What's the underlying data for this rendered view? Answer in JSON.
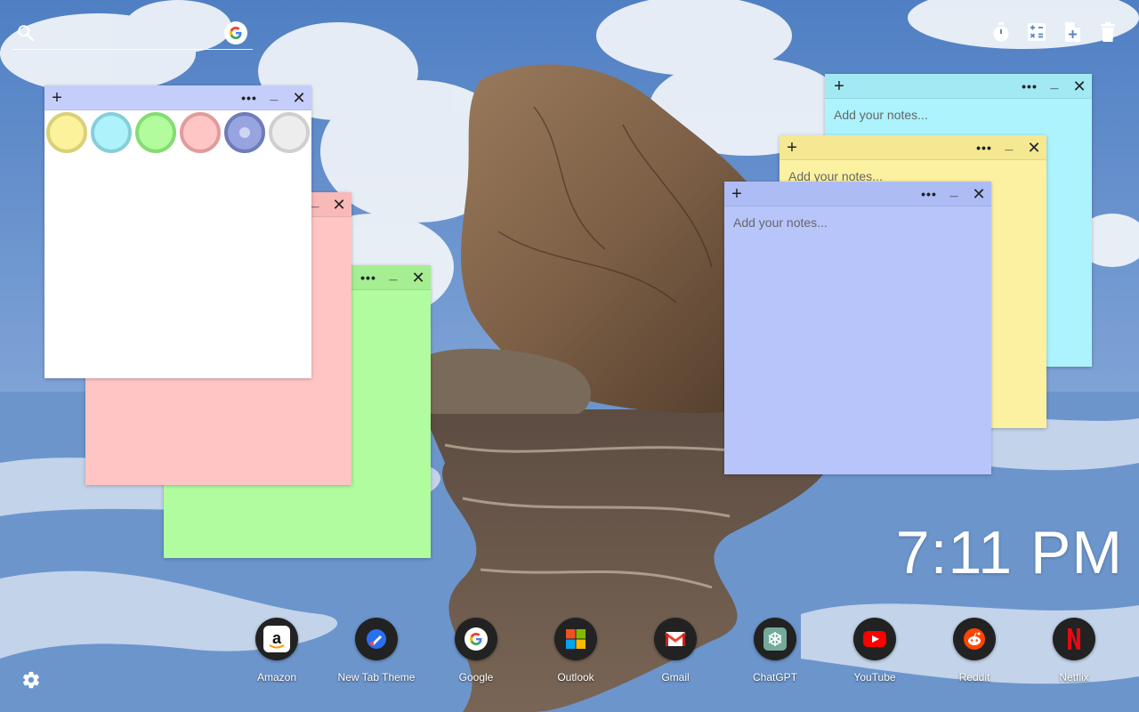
{
  "search": {
    "placeholder": ""
  },
  "top_tools": [
    "stopwatch-icon",
    "calculator-icon",
    "add-note-icon",
    "trash-icon"
  ],
  "notes": {
    "placeholder": "Add your notes...",
    "add_symbol": "+",
    "more_symbol": "•••",
    "min_symbol": "_",
    "close_symbol": "✕"
  },
  "note_colors": {
    "yellow": "#fcf1a1",
    "cyan": "#acf3fd",
    "green": "#b1fc9e",
    "pink": "#ffc5c5",
    "blue": "#b8c5fb",
    "white": "#ffffff"
  },
  "swatches": [
    {
      "name": "yellow",
      "fill": "#fdf29c",
      "ring": "#d9d077"
    },
    {
      "name": "cyan",
      "fill": "#aef2fc",
      "ring": "#86cfd9"
    },
    {
      "name": "green",
      "fill": "#b2fc9e",
      "ring": "#85dc72"
    },
    {
      "name": "pink",
      "fill": "#ffc6c6",
      "ring": "#e29b9b"
    },
    {
      "name": "blue",
      "fill": "#97a4e0",
      "ring": "#6f7cb8",
      "selected": true
    },
    {
      "name": "white",
      "fill": "#ededed",
      "ring": "#cfcfcf"
    }
  ],
  "clock": {
    "time": "7:11 PM"
  },
  "shortcuts": [
    {
      "label": "Amazon",
      "icon": "amazon-icon"
    },
    {
      "label": "New Tab Theme",
      "icon": "new-tab-theme-icon"
    },
    {
      "label": "Google",
      "icon": "google-icon"
    },
    {
      "label": "Outlook",
      "icon": "outlook-icon"
    },
    {
      "label": "Gmail",
      "icon": "gmail-icon"
    },
    {
      "label": "ChatGPT",
      "icon": "chatgpt-icon"
    },
    {
      "label": "YouTube",
      "icon": "youtube-icon"
    },
    {
      "label": "Reddit",
      "icon": "reddit-icon"
    },
    {
      "label": "Netflix",
      "icon": "netflix-icon"
    }
  ],
  "settings_icon": "gear-icon"
}
